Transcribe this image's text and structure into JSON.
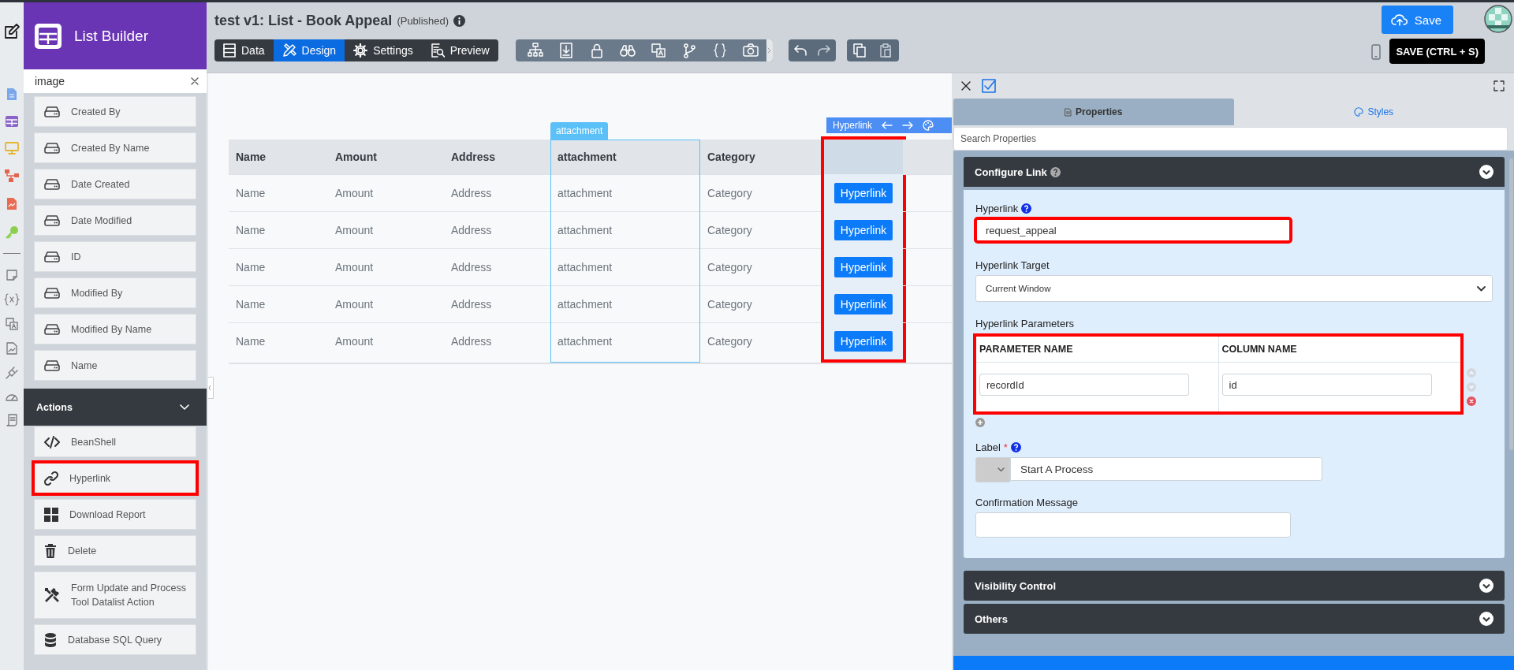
{
  "sidebar": {
    "title": "List Builder",
    "search": {
      "value": "image"
    },
    "items": [
      {
        "label": "Created By",
        "highlighted": false
      },
      {
        "label": "Created By Name",
        "highlighted": false
      },
      {
        "label": "Date Created",
        "highlighted": false
      },
      {
        "label": "Date Modified",
        "highlighted": false
      },
      {
        "label": "ID",
        "highlighted": false
      },
      {
        "label": "Modified By",
        "highlighted": false
      },
      {
        "label": "Modified By Name",
        "highlighted": false
      },
      {
        "label": "Name",
        "highlighted": false
      }
    ],
    "sections": [
      {
        "title": "Actions",
        "expanded": true,
        "items": [
          {
            "label": "BeanShell",
            "highlighted": false
          },
          {
            "label": "Hyperlink",
            "highlighted": true
          },
          {
            "label": "Download Report",
            "highlighted": false
          },
          {
            "label": "Delete",
            "highlighted": false
          },
          {
            "label": "Form Update and Process Tool Datalist Action",
            "highlighted": false
          },
          {
            "label": "Database SQL Query",
            "highlighted": false
          }
        ]
      }
    ]
  },
  "header": {
    "title": "test v1: List - Book Appeal",
    "status": "(Published)",
    "mode_tabs": [
      {
        "label": "Data",
        "selected": false
      },
      {
        "label": "Design",
        "selected": true
      },
      {
        "label": "Settings",
        "selected": false
      },
      {
        "label": "Preview",
        "selected": false
      }
    ],
    "save_button": {
      "label": "Save"
    },
    "save_tooltip": "SAVE (CTRL + S)"
  },
  "table": {
    "columns": [
      {
        "label": "Name",
        "selected": false
      },
      {
        "label": "Amount",
        "selected": false
      },
      {
        "label": "Address",
        "selected": false
      },
      {
        "label": "attachment",
        "selected": true,
        "tag": "attachment"
      },
      {
        "label": "Category",
        "selected": false
      }
    ],
    "rows": [
      [
        "Name",
        "Amount",
        "Address",
        "attachment",
        "Category"
      ],
      [
        "Name",
        "Amount",
        "Address",
        "attachment",
        "Category"
      ],
      [
        "Name",
        "Amount",
        "Address",
        "attachment",
        "Category"
      ],
      [
        "Name",
        "Amount",
        "Address",
        "attachment",
        "Category"
      ],
      [
        "Name",
        "Amount",
        "Address",
        "attachment",
        "Category"
      ]
    ],
    "action_column": {
      "highlighted": true,
      "toolbar_label": "Hyperlink",
      "buttons": [
        "Hyperlink",
        "Hyperlink",
        "Hyperlink",
        "Hyperlink",
        "Hyperlink"
      ]
    }
  },
  "properties_panel": {
    "tabs": [
      {
        "label": "Properties",
        "selected": true
      },
      {
        "label": "Styles",
        "selected": false
      }
    ],
    "search": {
      "placeholder": "Search Properties"
    },
    "sections": [
      {
        "title": "Configure Link",
        "expanded": true
      },
      {
        "title": "Visibility Control",
        "expanded": false
      },
      {
        "title": "Others",
        "expanded": false
      }
    ],
    "configure_link": {
      "hyperlink": {
        "label": "Hyperlink",
        "value": "request_appeal",
        "highlighted": true
      },
      "target": {
        "label": "Hyperlink Target",
        "value": "Current Window"
      },
      "parameters": {
        "label": "Hyperlink Parameters",
        "highlighted": true,
        "columns": [
          "PARAMETER NAME",
          "COLUMN NAME"
        ],
        "rows": [
          [
            "recordId",
            "id"
          ]
        ]
      },
      "label_field": {
        "label": "Label",
        "required_mark": "*",
        "value": "Start A Process"
      },
      "confirmation": {
        "label": "Confirmation Message"
      }
    }
  }
}
